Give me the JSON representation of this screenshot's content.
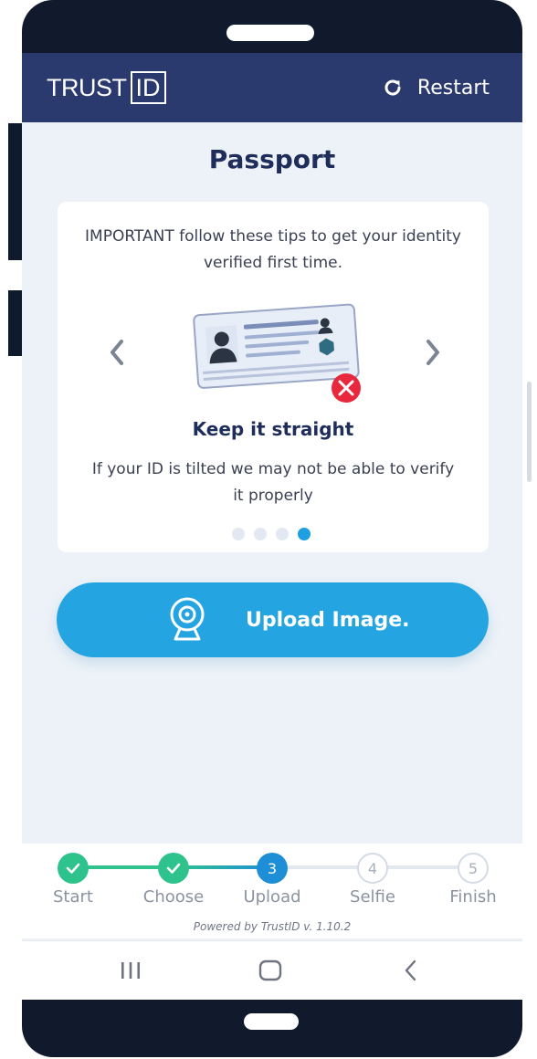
{
  "header": {
    "logo_text": "TRUST",
    "logo_id": "ID",
    "restart_label": "Restart"
  },
  "page": {
    "title": "Passport"
  },
  "tip_card": {
    "intro": "IMPORTANT follow these tips to get your identity verified first time.",
    "title": "Keep it straight",
    "body": "If your ID is tilted we may not be able to verify it properly",
    "dots_total": 4,
    "active_dot": 4
  },
  "upload": {
    "label": "Upload Image."
  },
  "progress": {
    "steps": [
      {
        "label": "Start",
        "status": "done",
        "number": "1"
      },
      {
        "label": "Choose",
        "status": "done",
        "number": "2"
      },
      {
        "label": "Upload",
        "status": "current",
        "number": "3"
      },
      {
        "label": "Selfie",
        "status": "todo",
        "number": "4"
      },
      {
        "label": "Finish",
        "status": "todo",
        "number": "5"
      }
    ],
    "powered_by": "Powered by TrustID v. 1.10.2"
  },
  "colors": {
    "header_bg": "#2b3a6e",
    "accent_blue": "#24a4e0",
    "done_green": "#2ec38c",
    "error_red": "#e8283c"
  },
  "icons": {
    "restart": "restart-icon",
    "prev": "chevron-left-icon",
    "next": "chevron-right-icon",
    "upload": "webcam-icon",
    "check": "check-icon",
    "nav_recent": "recent-apps-icon",
    "nav_home": "home-icon",
    "nav_back": "back-icon"
  }
}
